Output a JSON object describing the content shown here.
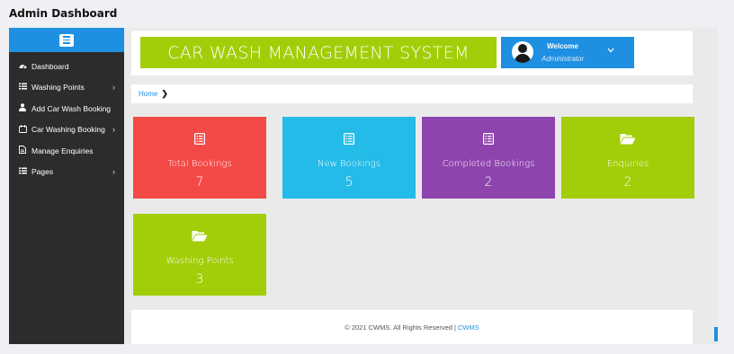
{
  "page": {
    "heading": "Admin Dashboard"
  },
  "sidebar": {
    "toggle_icon": "menu-icon",
    "items": [
      {
        "label": "Dashboard",
        "icon": "dashboard-icon",
        "has_submenu": false
      },
      {
        "label": "Washing Points",
        "icon": "list-icon",
        "has_submenu": true
      },
      {
        "label": "Add Car Wash Booking",
        "icon": "user-icon",
        "has_submenu": false
      },
      {
        "label": "Car Washing Booking",
        "icon": "car-icon",
        "has_submenu": true
      },
      {
        "label": "Manage Enquiries",
        "icon": "file-icon",
        "has_submenu": false
      },
      {
        "label": "Pages",
        "icon": "list-icon",
        "has_submenu": true
      }
    ]
  },
  "header": {
    "brand": "CAR WASH MANAGEMENT SYSTEM",
    "user": {
      "greeting": "Welcome",
      "role": "Administrator"
    }
  },
  "breadcrumb": {
    "home": "Home",
    "separator": "❯"
  },
  "tiles": [
    {
      "label": "Total Bookings",
      "value": "7",
      "icon": "list-alt-icon",
      "color": "#f44a47"
    },
    {
      "label": "New Bookings",
      "value": "5",
      "icon": "list-alt-icon",
      "color": "#24bbe9"
    },
    {
      "label": "Completed Bookings",
      "value": "2",
      "icon": "list-alt-icon",
      "color": "#8e44ad"
    },
    {
      "label": "Enquiries",
      "value": "2",
      "icon": "folder-open-icon",
      "color": "#a2ce09"
    },
    {
      "label": "Washing Points",
      "value": "3",
      "icon": "folder-open-icon",
      "color": "#a2ce09"
    }
  ],
  "footer": {
    "text": "© 2021 CWMS. All Rights Reserved |",
    "link": "CWMS"
  },
  "colors": {
    "accent": "#1e8fe1",
    "brand": "#a2ce09",
    "sidebar": "#2c2c2c"
  }
}
